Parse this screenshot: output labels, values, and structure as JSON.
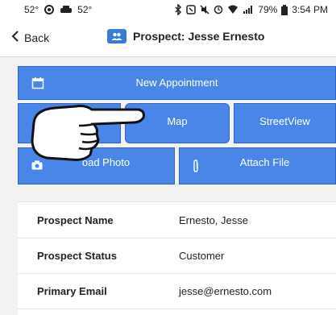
{
  "status_bar": {
    "temp1": "52°",
    "temp2": "52°",
    "battery": "79%",
    "time": "3:54 PM"
  },
  "nav": {
    "back_label": "Back",
    "title": "Prospect: Jesse Ernesto"
  },
  "actions": {
    "new_appointment": "New Appointment",
    "map": "Map",
    "streetview": "StreetView",
    "upload_photo": "oad Photo",
    "attach_file": "Attach File"
  },
  "details": {
    "rows": [
      {
        "label": "Prospect Name",
        "value": "Ernesto, Jesse"
      },
      {
        "label": "Prospect Status",
        "value": "Customer"
      },
      {
        "label": "Primary Email",
        "value": "jesse@ernesto.com"
      }
    ]
  },
  "colors": {
    "button_blue": "#4a86e8",
    "title_icon_blue": "#3a7bd5"
  },
  "icons": [
    "calendar-icon",
    "camera-icon",
    "paperclip-icon",
    "contacts-icon",
    "pointing-hand-icon"
  ]
}
